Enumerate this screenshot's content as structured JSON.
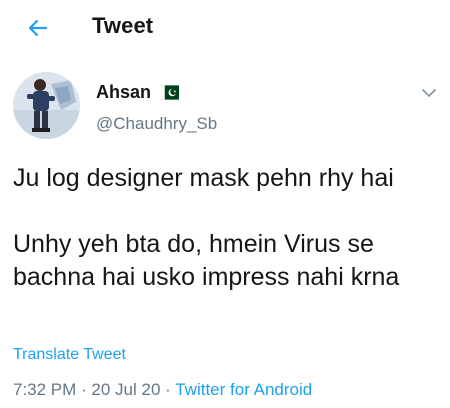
{
  "header": {
    "title": "Tweet",
    "back_icon": "arrow-left-icon"
  },
  "tweet": {
    "author_name": "Ahsan",
    "author_flag": "pakistan-flag-icon",
    "handle": "@Chaudhry_Sb",
    "menu_icon": "chevron-down-icon",
    "text_paragraph_1": "Ju log designer mask pehn rhy hai",
    "text_paragraph_2": "Unhy yeh bta do, hmein Virus se bachna hai usko impress nahi krna",
    "translate_label": "Translate Tweet",
    "time": "7:32 PM",
    "date": "20 Jul 20",
    "separator": " · ",
    "source": "Twitter for Android"
  },
  "colors": {
    "accent": "#1da1f2",
    "text": "#14171a",
    "muted": "#657786",
    "flag_green": "#01411c"
  }
}
